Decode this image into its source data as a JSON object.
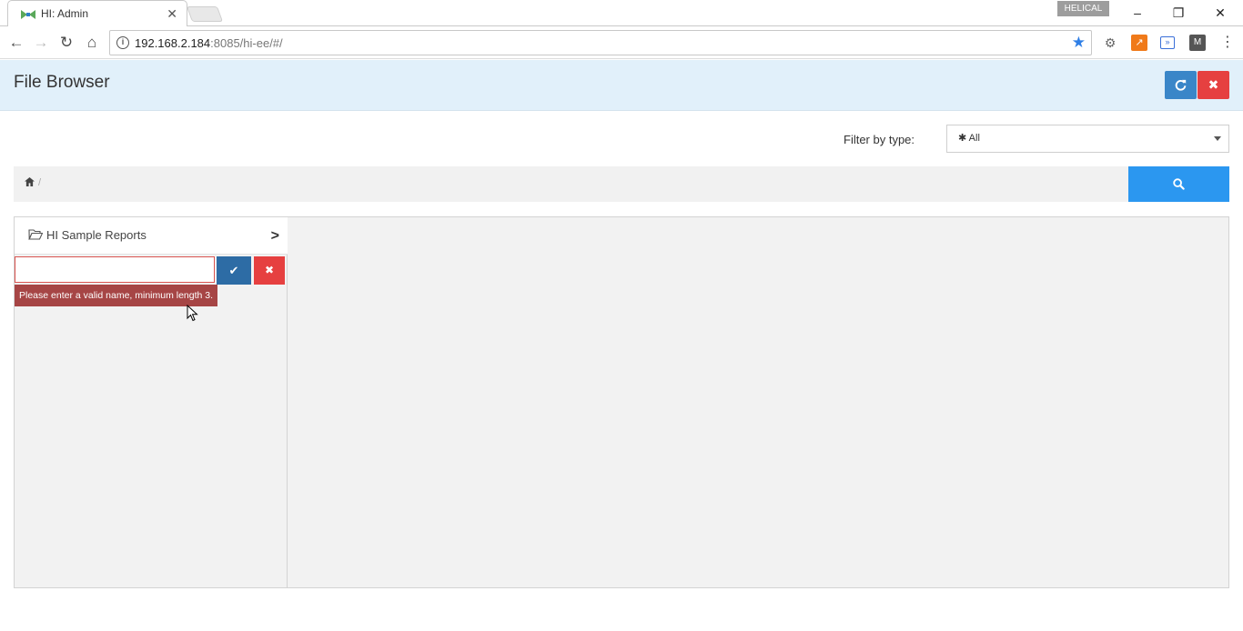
{
  "browser": {
    "tab_title": "HI: Admin",
    "tab_close": "✕",
    "profile_name": "HELICAL",
    "url_host": "192.168.2.184",
    "url_rest": ":8085/hi-ee/#/"
  },
  "header": {
    "title": "File Browser"
  },
  "filter": {
    "label": "Filter by type:",
    "selected": "✱ All"
  },
  "breadcrumb": {
    "separator": "/"
  },
  "tree": {
    "folder_label": "HI Sample Reports"
  },
  "rename": {
    "value": "",
    "error": "Please enter a valid name, minimum length 3."
  },
  "colors": {
    "header_bg": "#e1f0fa",
    "primary": "#2b97f0",
    "refresh_btn": "#3a86c8",
    "close_btn": "#e64040",
    "confirm_btn": "#2d6ca5",
    "error_bg": "#a64545"
  },
  "icons": {
    "refresh": "refresh-icon",
    "close": "close-icon",
    "search": "search-icon",
    "home": "home-icon",
    "folder": "folder-open-icon",
    "chevron": "chevron-right-icon",
    "check": "check-icon"
  }
}
